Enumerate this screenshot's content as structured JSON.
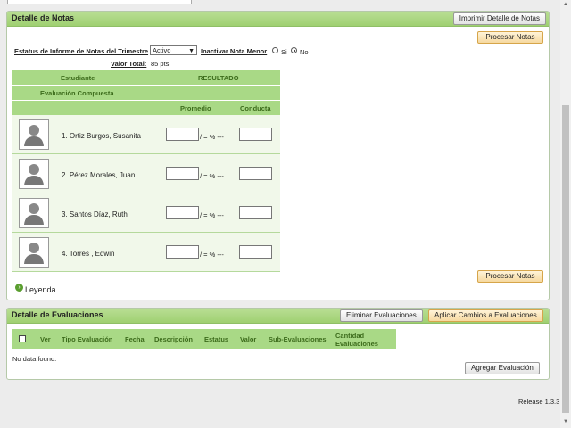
{
  "notas": {
    "title": "Detalle de Notas",
    "print_button": "Imprimir Detalle de Notas",
    "process_button": "Procesar Notas",
    "status_label": "Estatus de Informe de Notas del Trimestre",
    "status_value": "Activo",
    "inactivar_label": "Inactivar Nota Menor",
    "radio_si": "Si",
    "radio_no": "No",
    "radio_selected": "No",
    "valor_total_label": "Valor Total:",
    "valor_total_value": "85 pts",
    "header": {
      "estudiante": "Estudiante",
      "resultado": "RESULTADO",
      "evaluacion_compuesta": "Evaluación Compuesta",
      "promedio": "Promedio",
      "conducta": "Conducta"
    },
    "students": [
      {
        "name": "1. Ortiz Burgos, Susanita",
        "pct": "/ = % ---"
      },
      {
        "name": "2. Pérez Morales, Juan",
        "pct": "/ = % ---"
      },
      {
        "name": "3. Santos Díaz, Ruth",
        "pct": "/ = % ---"
      },
      {
        "name": "4. Torres , Edwin",
        "pct": "/ = % ---"
      }
    ],
    "leyenda": "Leyenda"
  },
  "evaluaciones": {
    "title": "Detalle de Evaluaciones",
    "delete_button": "Eliminar Evaluaciones",
    "apply_button": "Aplicar Cambios a Evaluaciones",
    "columns": [
      "Ver",
      "Tipo Evaluación",
      "Fecha",
      "Descripción",
      "Estatus",
      "Valor",
      "Sub-Evaluaciones",
      "Cantidad Evaluaciones"
    ],
    "empty_text": "No data found.",
    "add_button": "Agregar Evaluación"
  },
  "footer": {
    "release": "Release 1.3.3"
  },
  "colors": {
    "header_green": "#a9d986",
    "panel_green": "#b9de94",
    "accent_orange": "#f6d9a0"
  }
}
